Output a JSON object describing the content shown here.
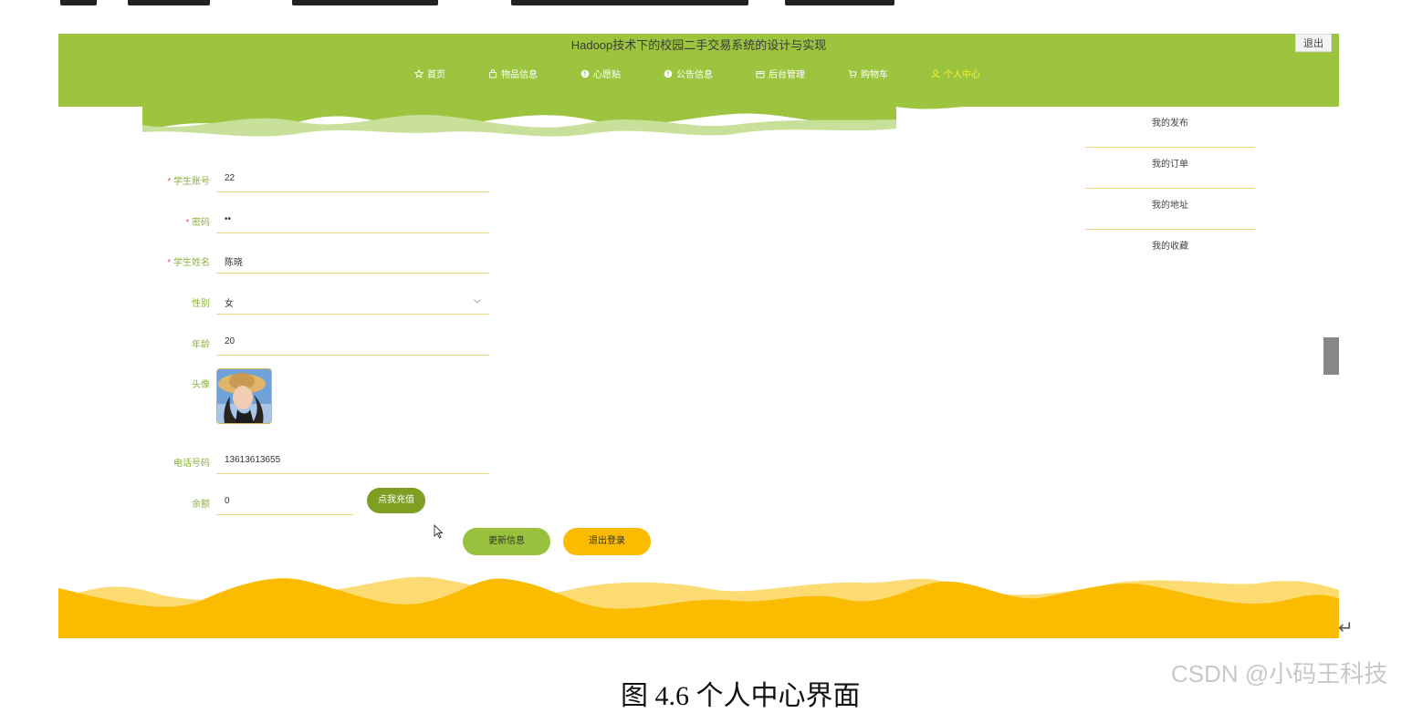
{
  "site_title": "Hadoop技术下的校园二手交易系统的设计与实现",
  "logout_top": "退出",
  "nav": [
    {
      "label": "首页",
      "icon": "star-icon"
    },
    {
      "label": "物品信息",
      "icon": "bag-icon"
    },
    {
      "label": "心愿贴",
      "icon": "info-icon"
    },
    {
      "label": "公告信息",
      "icon": "info-icon"
    },
    {
      "label": "后台管理",
      "icon": "box-icon"
    },
    {
      "label": "购物车",
      "icon": "cart-icon"
    },
    {
      "label": "个人中心",
      "icon": "user-icon",
      "active": true
    }
  ],
  "side_menu": [
    "我的发布",
    "我的订单",
    "我的地址",
    "我的收藏"
  ],
  "form": {
    "account_label": "学生账号",
    "account_value": "22",
    "password_label": "密码",
    "password_value": "••",
    "name_label": "学生姓名",
    "name_value": "陈晓",
    "gender_label": "性别",
    "gender_value": "女",
    "age_label": "年龄",
    "age_value": "20",
    "avatar_label": "头像",
    "phone_label": "电话号码",
    "phone_value": "13613613655",
    "balance_label": "余额",
    "balance_value": "0",
    "required_mark": "*"
  },
  "buttons": {
    "recharge": "点我充值",
    "update": "更新信息",
    "logout": "退出登录"
  },
  "caption": "图 4.6 个人中心界面",
  "watermark": "CSDN @小码王科技",
  "return_mark": "↵",
  "colors": {
    "header_green": "#9dc43f",
    "accent_yellow": "#fbbb00",
    "label_green": "#8ab23a",
    "active_nav": "#f5f52a"
  }
}
